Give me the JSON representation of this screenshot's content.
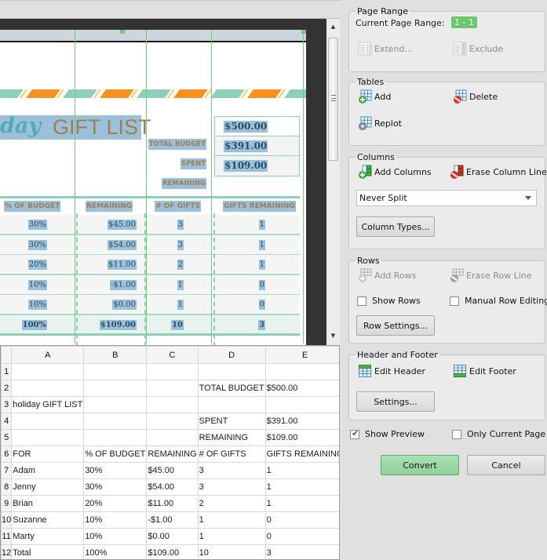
{
  "preview": {
    "title_italic": "day",
    "title_main": "GIFT LIST",
    "summary": [
      {
        "label": "TOTAL BUDGET",
        "value": "$500.00"
      },
      {
        "label": "SPENT",
        "value": "$391.00"
      },
      {
        "label": "REMAINING",
        "value": "$109.00"
      }
    ],
    "table_headers": [
      "% OF BUDGET",
      "REMAINING",
      "# OF GIFTS",
      "GIFTS REMAINING"
    ],
    "table_rows": [
      [
        "30%",
        "$45.00",
        "3",
        "1"
      ],
      [
        "30%",
        "$54.00",
        "3",
        "1"
      ],
      [
        "20%",
        "$11.00",
        "2",
        "1"
      ],
      [
        "10%",
        "-$1.00",
        "1",
        "0"
      ],
      [
        "10%",
        "$0.00",
        "1",
        "0"
      ],
      [
        "100%",
        "$109.00",
        "10",
        "3"
      ]
    ],
    "colors": {
      "teal": "#8fcfb9",
      "orange": "#f7901e",
      "yellow": "#f5c842",
      "highlight": "#9bc1da",
      "brown": "#a07d52"
    }
  },
  "grid": {
    "columns": [
      "A",
      "B",
      "C",
      "D",
      "E"
    ],
    "rows": [
      {
        "n": "1",
        "cells": [
          "",
          "",
          "",
          "",
          ""
        ]
      },
      {
        "n": "2",
        "cells": [
          "",
          "",
          "",
          "TOTAL BUDGET",
          "$500.00"
        ]
      },
      {
        "n": "3",
        "cells": [
          "holiday  GIFT LIST",
          "",
          "",
          "",
          ""
        ]
      },
      {
        "n": "4",
        "cells": [
          "",
          "",
          "",
          "SPENT",
          "$391.00"
        ]
      },
      {
        "n": "5",
        "cells": [
          "",
          "",
          "",
          "REMAINING",
          "$109.00"
        ]
      },
      {
        "n": "6",
        "cells": [
          "FOR",
          "% OF BUDGET",
          "REMAINING",
          "# OF GIFTS",
          "GIFTS REMAINING"
        ]
      },
      {
        "n": "7",
        "cells": [
          "Adam",
          "30%",
          "$45.00",
          "3",
          "1"
        ]
      },
      {
        "n": "8",
        "cells": [
          "Jenny",
          "30%",
          "$54.00",
          "3",
          "1"
        ]
      },
      {
        "n": "9",
        "cells": [
          "Brian",
          "20%",
          "$11.00",
          "2",
          "1"
        ]
      },
      {
        "n": "10",
        "cells": [
          "Suzanne",
          "10%",
          "-$1.00",
          "1",
          "0"
        ]
      },
      {
        "n": "11",
        "cells": [
          "Marty",
          "10%",
          "$0.00",
          "1",
          "0"
        ]
      },
      {
        "n": "12",
        "cells": [
          "Total",
          "100%",
          "$109.00",
          "10",
          "3"
        ]
      }
    ]
  },
  "panel": {
    "page_range": {
      "legend": "Page Range",
      "current_label": "Current Page Range:",
      "current_value": "1 - 1",
      "extend": "Extend...",
      "exclude": "Exclude"
    },
    "tables": {
      "legend": "Tables",
      "add": "Add",
      "delete": "Delete",
      "replot": "Replot"
    },
    "columns": {
      "legend": "Columns",
      "add": "Add Columns",
      "erase": "Erase Column Line",
      "split_selected": "Never Split",
      "types_button": "Column Types..."
    },
    "rows": {
      "legend": "Rows",
      "add": "Add Rows",
      "erase": "Erase Row Line",
      "show_rows": "Show Rows",
      "show_rows_checked": false,
      "manual": "Manual Row Editing",
      "manual_checked": false,
      "settings_button": "Row Settings..."
    },
    "header_footer": {
      "legend": "Header and Footer",
      "edit_header": "Edit Header",
      "edit_footer": "Edit Footer",
      "settings_button": "Settings..."
    },
    "show_preview": "Show Preview",
    "show_preview_checked": true,
    "only_current_page": "Only Current Page",
    "only_current_page_checked": false,
    "convert_button": "Convert",
    "cancel_button": "Cancel"
  }
}
